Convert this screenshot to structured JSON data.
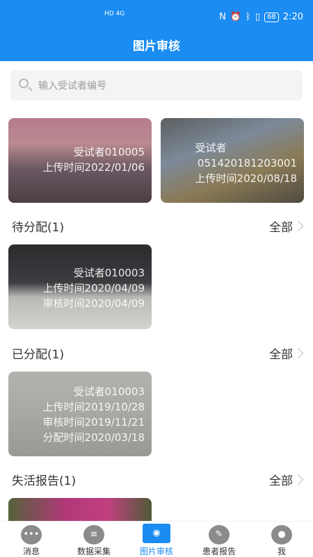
{
  "status_bar": {
    "network": "HD 4G",
    "battery": "68",
    "time": "2:20"
  },
  "header": {
    "title": "图片审核"
  },
  "search": {
    "placeholder": "输入受试者编号"
  },
  "top_cards": [
    {
      "lines": [
        "受试者010005",
        "上传时间2022/01/06"
      ]
    },
    {
      "lines": [
        "受试者",
        "051420181203001",
        "上传时间2020/08/18"
      ]
    }
  ],
  "sections": {
    "pending": {
      "title": "待分配(1)",
      "all": "全部",
      "card": {
        "lines": [
          "受试者010003",
          "上传时间2020/04/09",
          "审核时间2020/04/09"
        ]
      }
    },
    "assigned": {
      "title": "已分配(1)",
      "all": "全部",
      "card": {
        "lines": [
          "受试者010003",
          "上传时间2019/10/28",
          "审核时间2019/11/21",
          "分配时间2020/03/18"
        ]
      }
    },
    "inactive": {
      "title": "失活报告(1)",
      "all": "全部"
    }
  },
  "tabbar": {
    "items": [
      {
        "label": "消息",
        "icon": "chat-icon"
      },
      {
        "label": "数据采集",
        "icon": "database-icon"
      },
      {
        "label": "图片审核",
        "icon": "camera-icon",
        "active": true
      },
      {
        "label": "患者报告",
        "icon": "report-icon"
      },
      {
        "label": "我",
        "icon": "user-icon"
      }
    ]
  },
  "colors": {
    "primary": "#1a8cf2"
  }
}
